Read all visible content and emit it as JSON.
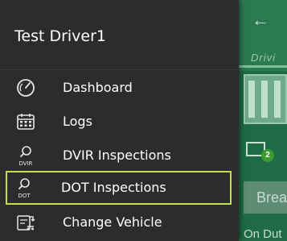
{
  "drawer": {
    "driver_name": "Test Driver1",
    "items": [
      {
        "label": "Dashboard",
        "icon": "speedometer-icon"
      },
      {
        "label": "Logs",
        "icon": "calendar-icon"
      },
      {
        "label": "DVIR Inspections",
        "icon": "search-icon",
        "icon_text": "DVIR"
      },
      {
        "label": "DOT Inspections",
        "icon": "search-icon",
        "icon_text": "DOT",
        "active": true
      },
      {
        "label": "Change Vehicle",
        "icon": "change-vehicle-icon"
      }
    ]
  },
  "background": {
    "back_icon": "←",
    "driver_partial": "Drivi",
    "message_badge": "2",
    "break_partial": "Breal",
    "status_partial": "On Dut"
  },
  "colors": {
    "drawer_bg": "#2c2c2c",
    "active_border": "#bfe04a",
    "app_green": "#1f6b46"
  }
}
